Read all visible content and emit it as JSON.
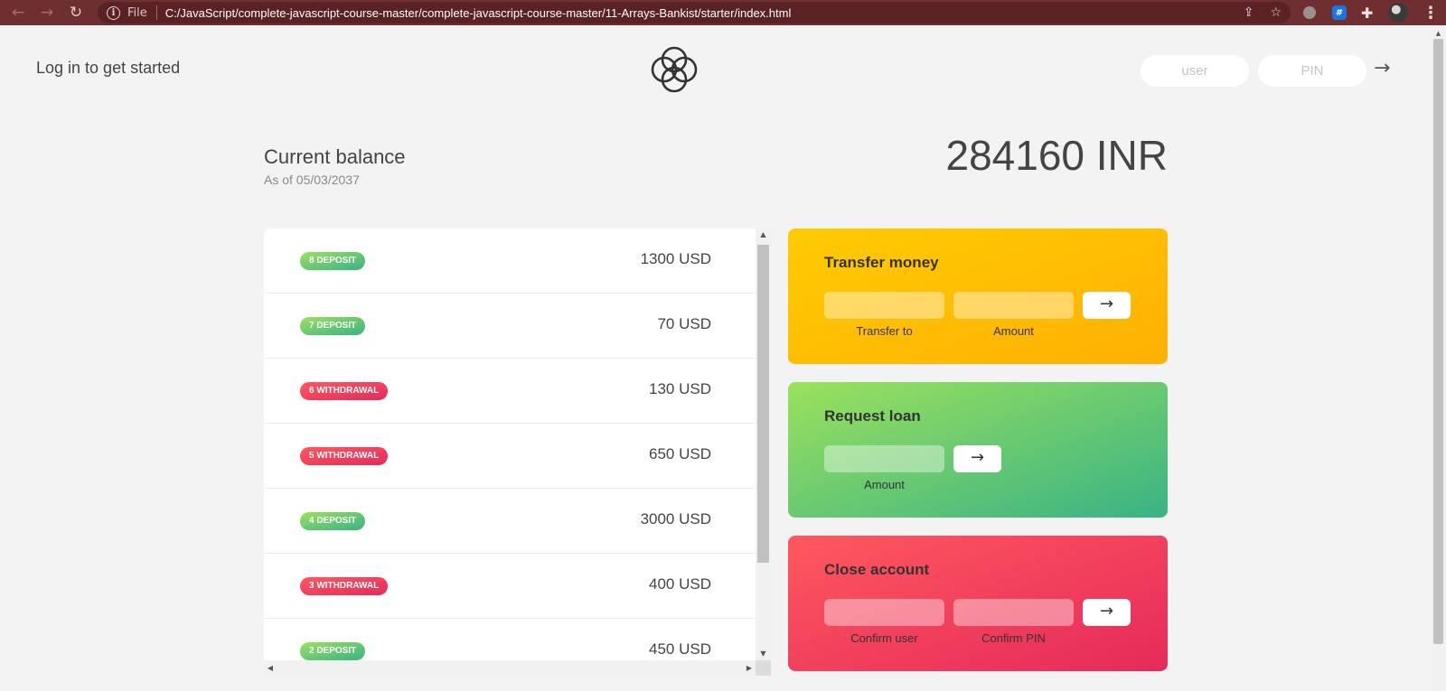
{
  "browser": {
    "file_label": "File",
    "url": "C:/JavaScript/complete-javascript-course-master/complete-javascript-course-master/11-Arrays-Bankist/starter/index.html"
  },
  "nav": {
    "welcome": "Log in to get started",
    "user_placeholder": "user",
    "pin_placeholder": "PIN",
    "login_arrow": "→"
  },
  "balance": {
    "label": "Current balance",
    "date_prefix": "As of",
    "date": "05/03/2037",
    "value": "284160 INR"
  },
  "movements": [
    {
      "type_label": "8 deposit",
      "kind": "deposit",
      "value": "1300 USD"
    },
    {
      "type_label": "7 deposit",
      "kind": "deposit",
      "value": "70 USD"
    },
    {
      "type_label": "6 withdrawal",
      "kind": "withdrawal",
      "value": "130 USD"
    },
    {
      "type_label": "5 withdrawal",
      "kind": "withdrawal",
      "value": "650 USD"
    },
    {
      "type_label": "4 deposit",
      "kind": "deposit",
      "value": "3000 USD"
    },
    {
      "type_label": "3 withdrawal",
      "kind": "withdrawal",
      "value": "400 USD"
    },
    {
      "type_label": "2 deposit",
      "kind": "deposit",
      "value": "450 USD"
    }
  ],
  "operations": {
    "transfer": {
      "title": "Transfer money",
      "label_to": "Transfer to",
      "label_amount": "Amount",
      "button": "→"
    },
    "loan": {
      "title": "Request loan",
      "label_amount": "Amount",
      "button": "→"
    },
    "close": {
      "title": "Close account",
      "label_user": "Confirm user",
      "label_pin": "Confirm PIN",
      "button": "→"
    }
  },
  "colors": {
    "deposit_gradient": [
      "#39b385",
      "#9be15d"
    ],
    "withdrawal_gradient": [
      "#e52a5a",
      "#ff585f"
    ],
    "transfer_gradient": [
      "#ffb003",
      "#ffcb03"
    ],
    "chrome": "#6f2f31"
  }
}
